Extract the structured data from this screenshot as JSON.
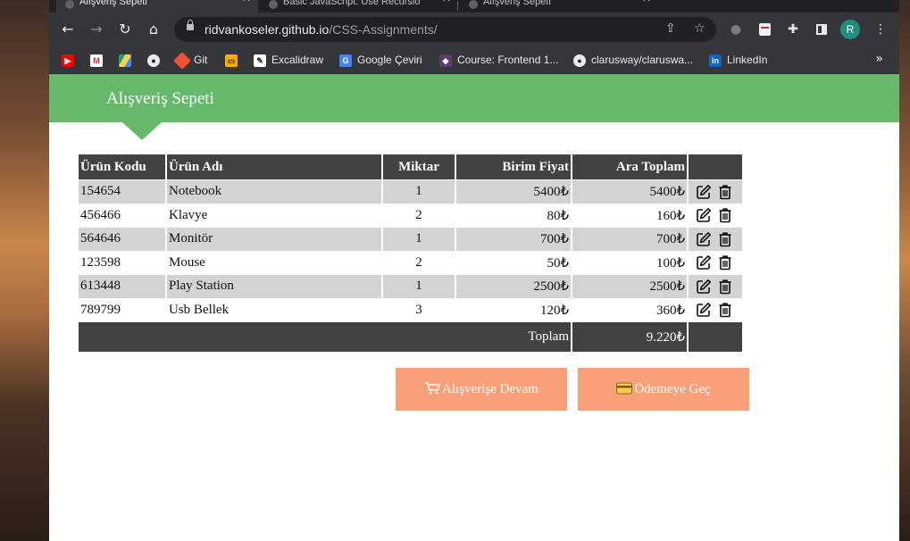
{
  "browser": {
    "tabs": [
      {
        "title": "Alışveriş Sepeti",
        "active": true
      },
      {
        "title": "Basic JavaScript: Use Recursio",
        "active": false
      },
      {
        "title": "Alışveriş Sepeti",
        "active": false
      }
    ],
    "url_host": "ridvankoseler.github.io",
    "url_path": "/CSS-Assignments/",
    "profile_initial": "R",
    "bookmarks": [
      {
        "label": "",
        "icon": "youtube-icon"
      },
      {
        "label": "",
        "icon": "gmail-icon"
      },
      {
        "label": "",
        "icon": "drive-icon"
      },
      {
        "label": "",
        "icon": "github-icon"
      },
      {
        "label": "Git",
        "icon": "git-icon"
      },
      {
        "label": "",
        "icon": "wallet-icon"
      },
      {
        "label": "Excalidraw",
        "icon": "excalidraw-icon"
      },
      {
        "label": "Google Çeviri",
        "icon": "translate-icon"
      },
      {
        "label": "Course: Frontend 1...",
        "icon": "course-icon"
      },
      {
        "label": "clarusway/claruswa...",
        "icon": "github-icon"
      },
      {
        "label": "LinkedIn",
        "icon": "linkedin-icon"
      }
    ]
  },
  "page": {
    "title": "Alışveriş Sepeti",
    "colors": {
      "banner": "#66b96a",
      "header": "#424242",
      "stripe": "#d3d3d3",
      "button": "#f7a07a"
    }
  },
  "table": {
    "headers": [
      "Ürün Kodu",
      "Ürün Adı",
      "Miktar",
      "Birim Fiyat",
      "Ara Toplam",
      ""
    ],
    "rows": [
      {
        "code": "154654",
        "name": "Notebook",
        "qty": "1",
        "unit": "5400₺",
        "subtotal": "5400₺"
      },
      {
        "code": "456466",
        "name": "Klavye",
        "qty": "2",
        "unit": "80₺",
        "subtotal": "160₺"
      },
      {
        "code": "564646",
        "name": "Monitör",
        "qty": "1",
        "unit": "700₺",
        "subtotal": "700₺"
      },
      {
        "code": "123598",
        "name": "Mouse",
        "qty": "2",
        "unit": "50₺",
        "subtotal": "100₺"
      },
      {
        "code": "613448",
        "name": "Play Station",
        "qty": "1",
        "unit": "2500₺",
        "subtotal": "2500₺"
      },
      {
        "code": "789799",
        "name": "Usb Bellek",
        "qty": "3",
        "unit": "120₺",
        "subtotal": "360₺"
      }
    ],
    "total_label": "Toplam",
    "total_value": "9.220₺",
    "row_actions": [
      "edit-icon",
      "trash-icon"
    ]
  },
  "buttons": {
    "continue": "Alışverişe Devam",
    "checkout": "Ödemeye Geç"
  }
}
